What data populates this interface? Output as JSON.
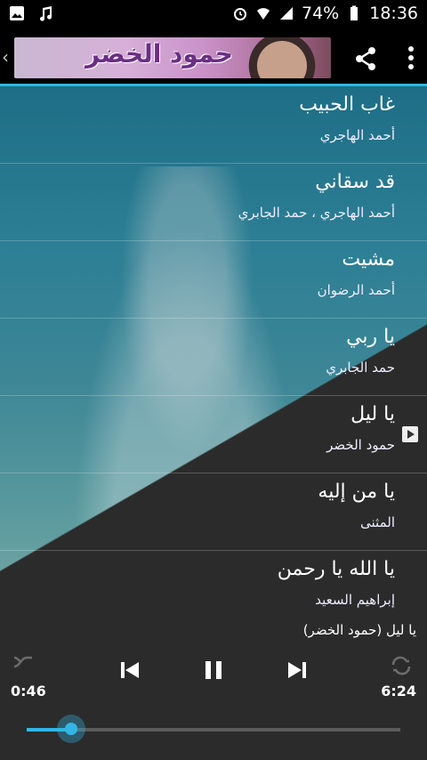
{
  "status": {
    "battery": "74%",
    "time": "18:36"
  },
  "app": {
    "banner_title": "حمود الخضر"
  },
  "songs": [
    {
      "title": "غاب الحبيب",
      "artist": "أحمد الهاجري"
    },
    {
      "title": "قد سقاني",
      "artist": "أحمد الهاجري ، حمد الجابري"
    },
    {
      "title": "مشيت",
      "artist": "أحمد الرضوان"
    },
    {
      "title": "يا ربي",
      "artist": "حمد الجابري"
    },
    {
      "title": "يا ليل",
      "artist": "حمود الخضر",
      "playing": true
    },
    {
      "title": "يا من إليه",
      "artist": "المثنى"
    },
    {
      "title": "يا الله يا رحمن",
      "artist": "إبراهيم السعيد"
    }
  ],
  "player": {
    "now_playing": "يا ليل (حمود الخضر)",
    "current_time": "0:46",
    "duration": "6:24",
    "progress": 0.12
  },
  "colors": {
    "accent": "#33b5e5",
    "player_bg": "#2b2b2b"
  }
}
